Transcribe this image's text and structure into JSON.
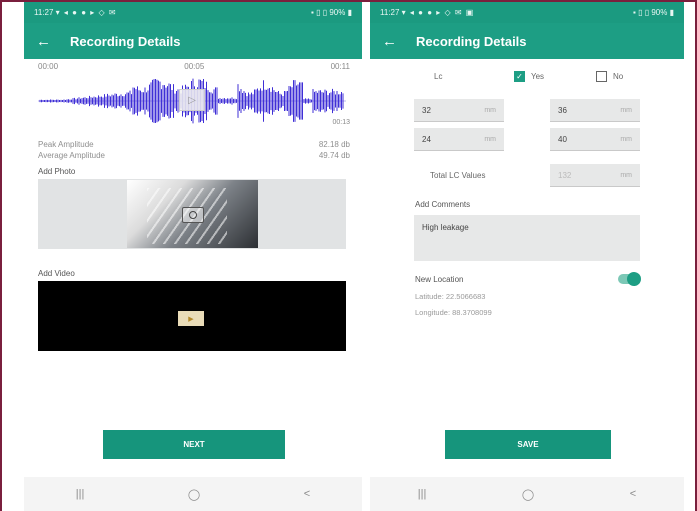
{
  "colors": {
    "primary": "#1d9e84",
    "frame": "#7a1f3d"
  },
  "left": {
    "status_time": "11:27",
    "status_icons": "▾ ◂ ● ● ▸ ◇ ✉",
    "status_right": "▪ ▯ ▯ 90% ▮",
    "title": "Recording Details",
    "time_start": "00:00",
    "time_mid": "00:05",
    "time_end": "00:11",
    "duration": "00:13",
    "peak_label": "Peak Amplitude",
    "peak_value": "82.18 db",
    "avg_label": "Average Amplitude",
    "avg_value": "49.74 db",
    "add_photo": "Add Photo",
    "add_video": "Add Video",
    "next": "NEXT"
  },
  "right": {
    "status_time": "11:27",
    "status_icons": "▾ ◂ ● ● ▸ ◇ ✉ ▣",
    "status_right": "▪ ▯ ▯ 90% ▮",
    "title": "Recording Details",
    "lc_label": "Lc",
    "yes": "Yes",
    "no": "No",
    "fields": [
      {
        "value": "32",
        "unit": "mm"
      },
      {
        "value": "36",
        "unit": "mm"
      },
      {
        "value": "24",
        "unit": "mm"
      },
      {
        "value": "40",
        "unit": "mm"
      }
    ],
    "total_label": "Total LC Values",
    "total_value": "132",
    "total_unit": "mm",
    "add_comments": "Add Comments",
    "comment": "High leakage",
    "new_location": "New Location",
    "latitude": "Latitude: 22.5066683",
    "longitude": "Longitude: 88.3708099",
    "save": "SAVE",
    "yes_checked": true,
    "no_checked": false,
    "new_location_toggle": true
  },
  "nav": {
    "recents": "|||",
    "home": "◯",
    "back": "<"
  }
}
